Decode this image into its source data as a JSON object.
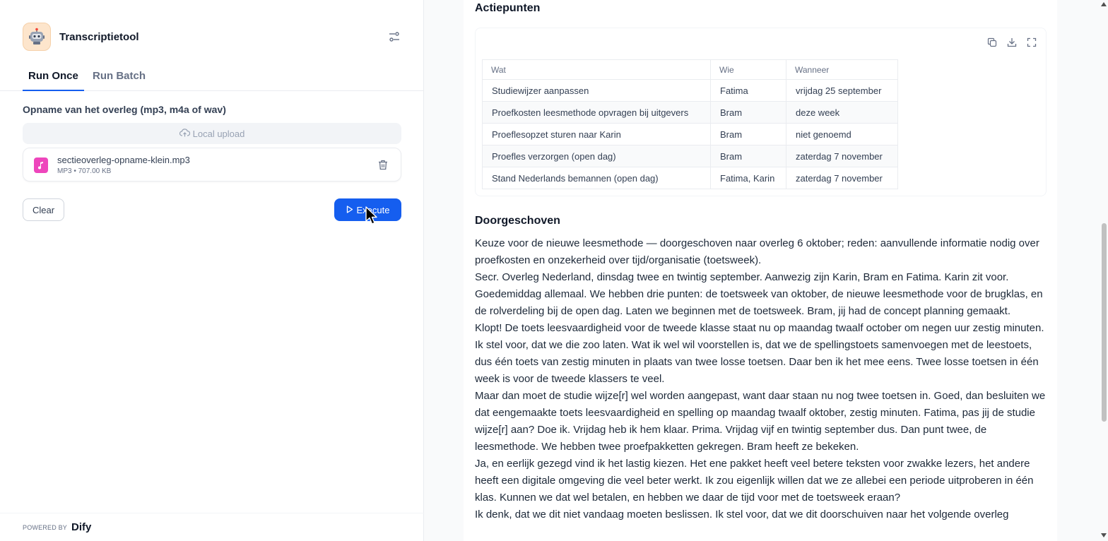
{
  "app": {
    "title": "Transcriptietool",
    "icon": "robot-icon"
  },
  "tabs": [
    {
      "label": "Run Once",
      "active": true
    },
    {
      "label": "Run Batch",
      "active": false
    }
  ],
  "form": {
    "field_label": "Opname van het overleg (mp3, m4a of wav)",
    "upload_label": "Local upload",
    "file": {
      "name": "sectieoverleg-opname-klein.mp3",
      "type": "MP3",
      "size": "707.00 KB"
    },
    "clear_label": "Clear",
    "execute_label": "Execute"
  },
  "footer": {
    "powered_by": "POWERED BY",
    "brand": "Dify"
  },
  "result": {
    "actiepunten_title": "Actiepunten",
    "table": {
      "headers": [
        "Wat",
        "Wie",
        "Wanneer"
      ],
      "rows": [
        [
          "Studiewijzer aanpassen",
          "Fatima",
          "vrijdag 25 september"
        ],
        [
          "Proefkosten leesmethode opvragen bij uitgevers",
          "Bram",
          "deze week"
        ],
        [
          "Proeflesopzet sturen naar Karin",
          "Bram",
          "niet genoemd"
        ],
        [
          "Proefles verzorgen (open dag)",
          "Bram",
          "zaterdag 7 november"
        ],
        [
          "Stand Nederlands bemannen (open dag)",
          "Fatima, Karin",
          "zaterdag 7 november"
        ]
      ]
    },
    "doorgeschoven_title": "Doorgeschoven",
    "paragraphs": [
      "Keuze voor de nieuwe leesmethode — doorgeschoven naar overleg 6 oktober; reden: aanvullende informatie nodig over proefkosten en onzekerheid over tijd/organisatie (toetsweek).",
      "Secr. Overleg Nederland, dinsdag twee en twintig september. Aanwezig zijn Karin, Bram en Fatima. Karin zit voor. Goedemiddag allemaal. We hebben drie punten: de toetsweek van oktober, de nieuwe leesmethode voor de brugklas, en de rolverdeling bij de open dag. Laten we beginnen met de toetsweek. Bram, jij had de concept planning gemaakt.",
      "Klopt! De toets leesvaardigheid voor de tweede klasse staat nu op maandag twaalf october om negen uur zestig minuten. Ik stel voor, dat we die zoo laten. Wat ik wel wil voorstellen is, dat we de spellingstoets samenvoegen met de leestoets, dus één toets van zestig minuten in plaats van twee losse toetsen. Daar ben ik het mee eens. Twee losse toetsen in één week is voor de tweede klassers te veel.",
      "Maar dan moet de studie wijze[r] wel worden aangepast, want daar staan nu nog twee toetsen in. Goed, dan besluiten we dat eengemaakte toets leesvaardigheid en spelling op maandag twaalf oktober, zestig minuten. Fatima, pas jij de studie wijze[r] aan? Doe ik. Vrijdag heb ik hem klaar. Prima. Vrijdag vijf en twintig september dus. Dan punt twee, de leesmethode. We hebben twee proefpakketten gekregen. Bram heeft ze bekeken.",
      "Ja, en eerlijk gezegd vind ik het lastig kiezen. Het ene pakket heeft veel betere teksten voor zwakke lezers, het andere heeft een digitale omgeving die veel beter werkt. Ik zou eigenlijk willen dat we ze allebei een periode uitproberen in één klas. Kunnen we dat wel betalen, en hebben we daar de tijd voor met de toetsweek eraan?",
      "Ik denk, dat we dit niet vandaag moeten beslissen. Ik stel voor, dat we dit doorschuiven naar het volgende overleg"
    ]
  },
  "colors": {
    "primary": "#155eef",
    "file_badge": "#ee46bc",
    "app_icon_bg": "#fde5cc"
  }
}
